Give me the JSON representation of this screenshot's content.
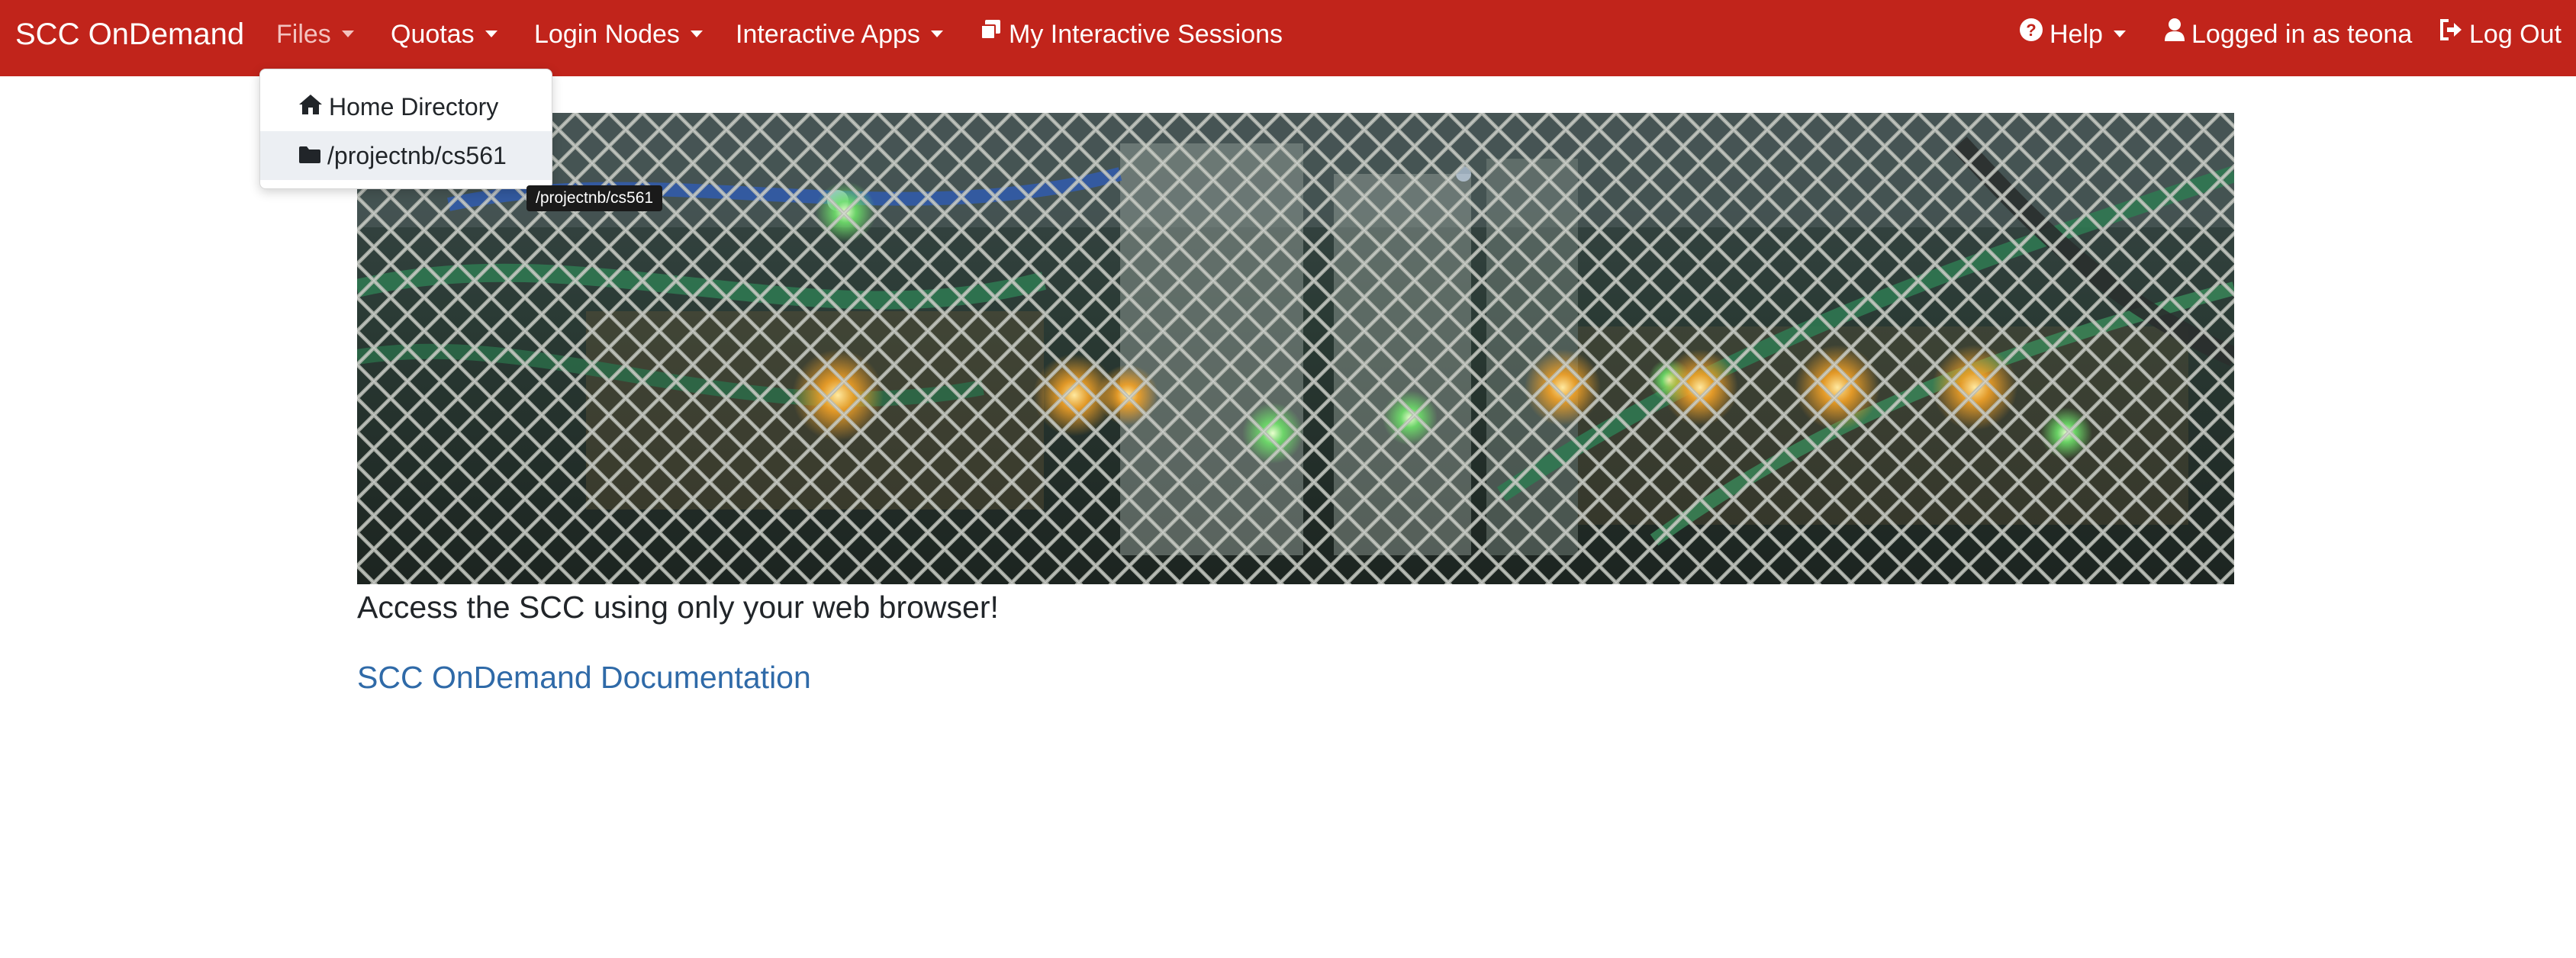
{
  "navbar": {
    "brand": "SCC OnDemand",
    "bg_color": "#c1241b",
    "menus": {
      "files": "Files",
      "quotas": "Quotas",
      "login_nodes": "Login Nodes",
      "interactive_apps": "Interactive Apps",
      "my_sessions": "My Interactive Sessions",
      "help": "Help",
      "logged_in": "Logged in as teona",
      "log_out": "Log Out"
    },
    "icons": {
      "my_sessions": "window-restore-icon",
      "help": "question-circle-icon",
      "user": "user-icon",
      "log_out": "sign-out-icon"
    }
  },
  "files_dropdown": {
    "items": [
      {
        "label": "Home Directory",
        "icon": "home-icon"
      },
      {
        "label": "/projectnb/cs561",
        "icon": "folder-icon"
      }
    ],
    "tooltip": "/projectnb/cs561"
  },
  "main": {
    "hero_image": "server-rack-behind-chain-link-fence",
    "tagline": "Access the SCC using only your web browser!",
    "doc_link": "SCC OnDemand Documentation",
    "link_color": "#2f6aa8"
  }
}
